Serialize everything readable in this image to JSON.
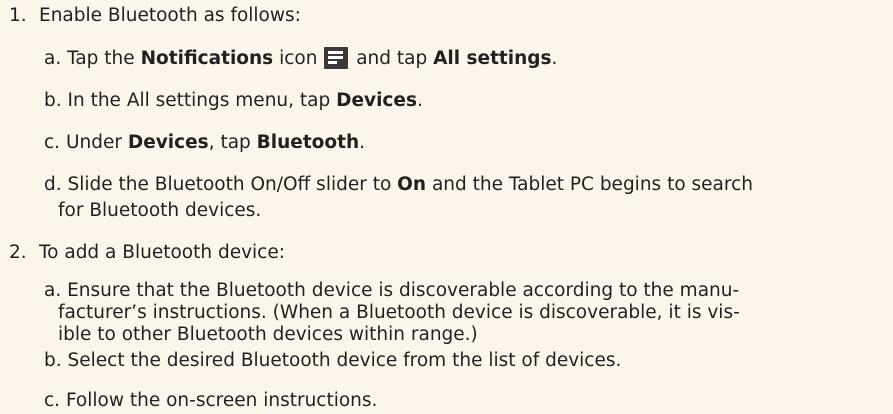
{
  "steps": [
    {
      "number": "1.",
      "text": "Enable Bluetooth as follows:",
      "substeps": [
        {
          "letter": "a.",
          "t1": "Tap the ",
          "b1": "Notifications",
          "t2": " icon ",
          "icon": "notifications-icon",
          "t3": " and tap ",
          "b2": "All settings",
          "t4": "."
        },
        {
          "letter": "b.",
          "t1": "In the All settings menu, tap ",
          "b1": "Devices",
          "t2": "."
        },
        {
          "letter": "c.",
          "t1": "Under ",
          "b1": "Devices",
          "t2": ", tap ",
          "b2": "Bluetooth",
          "t3": "."
        },
        {
          "letter": "d.",
          "t1": "Slide the Bluetooth On/Off slider to ",
          "b1": "On",
          "t2": " and the Tablet PC begins to search",
          "line2": "for Bluetooth devices."
        }
      ]
    },
    {
      "number": "2.",
      "text": "To add a Bluetooth device:",
      "substeps": [
        {
          "letter": "a.",
          "line1": "Ensure that the Bluetooth device is discoverable according to the manu-",
          "line2": "facturer’s instructions. (When a Bluetooth device is discoverable, it is vis-",
          "line3": "ible to other Bluetooth devices within range.)"
        },
        {
          "letter": "b.",
          "text": "Select the desired Bluetooth device from the list of devices."
        },
        {
          "letter": "c.",
          "text": "Follow the on-screen instructions."
        }
      ]
    }
  ]
}
